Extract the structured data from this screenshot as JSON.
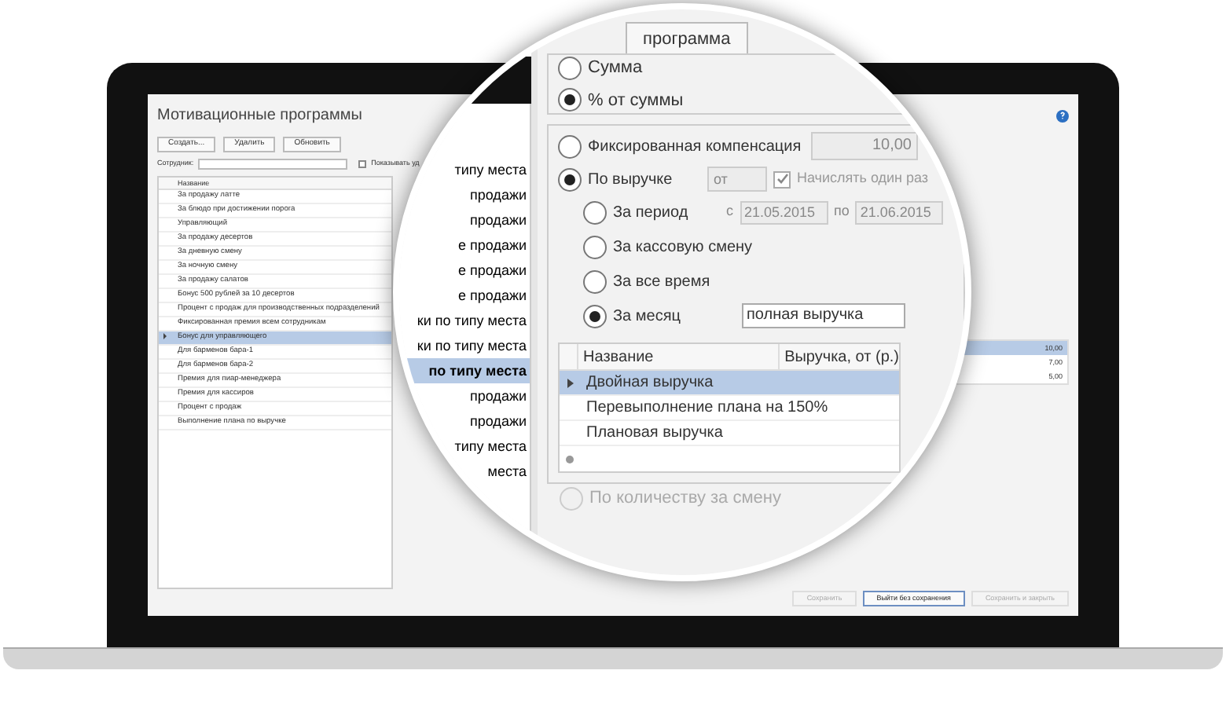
{
  "app": {
    "title": "Мотивационные программы",
    "buttons": [
      "Создать...",
      "Удалить",
      "Обновить"
    ],
    "employee_label": "Сотрудник:",
    "show_deleted": {
      "label": "Показывать уд",
      "checked": false
    },
    "column": "Название",
    "rows": [
      {
        "name": "За продажу латте",
        "selected": false
      },
      {
        "name": "За блюдо при достижении порога",
        "selected": false
      },
      {
        "name": "Управляющий",
        "selected": false
      },
      {
        "name": "За продажу десертов",
        "selected": false
      },
      {
        "name": "За дневную смену",
        "selected": false
      },
      {
        "name": "За ночную смену",
        "selected": false
      },
      {
        "name": "За продажу салатов",
        "selected": false
      },
      {
        "name": "Бонус 500 рублей за 10 десертов",
        "selected": false
      },
      {
        "name": "Процент с продаж для производственных подразделений",
        "selected": false
      },
      {
        "name": "Фиксированная премия всем сотрудникам",
        "selected": false
      },
      {
        "name": "Бонус для управляющего",
        "selected": true
      },
      {
        "name": "Для барменов бара-1",
        "selected": false
      },
      {
        "name": "Для барменов бара-2",
        "selected": false
      },
      {
        "name": "Премия для пиар-менеджера",
        "selected": false
      },
      {
        "name": "Премия для кассиров",
        "selected": false
      },
      {
        "name": "Процент с продаж",
        "selected": false
      },
      {
        "name": "Выполнение плана по выручке",
        "selected": false
      }
    ],
    "values": [
      {
        "text": "10,00",
        "selected": true
      },
      {
        "text": "7,00",
        "selected": false
      },
      {
        "text": "5,00",
        "selected": false
      }
    ],
    "footer_buttons": [
      {
        "label": "Сохранить",
        "disabled": true
      },
      {
        "label": "Выйти без сохранения",
        "disabled": false
      },
      {
        "label": "Сохранить и закрыть",
        "disabled": true
      }
    ]
  },
  "magnifier": {
    "comments": [
      {
        "text": "типу места",
        "selected": false
      },
      {
        "text": "продажи",
        "selected": false
      },
      {
        "text": "продажи",
        "selected": false
      },
      {
        "text": "е продажи",
        "selected": false
      },
      {
        "text": "е продажи",
        "selected": false
      },
      {
        "text": "е продажи",
        "selected": false
      },
      {
        "text": "ки по типу места",
        "selected": false
      },
      {
        "text": "ки по типу места",
        "selected": false
      },
      {
        "text": "по типу места",
        "selected": true
      },
      {
        "text": "продажи",
        "selected": false
      },
      {
        "text": "продажи",
        "selected": false
      },
      {
        "text": "типу места",
        "selected": false
      },
      {
        "text": "места",
        "selected": false
      }
    ],
    "tab": "программа",
    "amount_type": [
      {
        "label": "Сумма",
        "selected": false
      },
      {
        "label": "% от суммы",
        "selected": true
      }
    ],
    "fixed": {
      "label": "Фиксированная компенсация",
      "selected": false,
      "value": "10,00"
    },
    "by_revenue": {
      "label": "По выручке",
      "selected": true,
      "select": "от",
      "once": {
        "label": "Начислять один раз",
        "checked": true
      }
    },
    "periods": [
      {
        "label": "За период",
        "selected": false
      },
      {
        "label": "За кассовую смену",
        "selected": false
      },
      {
        "label": "За все время",
        "selected": false
      },
      {
        "label": "За месяц",
        "selected": true
      }
    ],
    "period_from_label": "с",
    "period_from": "21.05.2015",
    "period_to_label": "по",
    "period_to": "21.06.2015",
    "month_select": "полная выручка",
    "table": {
      "columns": [
        "Название",
        "Выручка, от (р.)"
      ],
      "rows": [
        {
          "name": "Двойная выручка",
          "selected": true
        },
        {
          "name": "Перевыполнение плана на 150%",
          "selected": false
        },
        {
          "name": "Плановая выручка",
          "selected": false
        }
      ]
    },
    "by_count": {
      "label": "По количеству за смену",
      "disabled": true
    }
  }
}
